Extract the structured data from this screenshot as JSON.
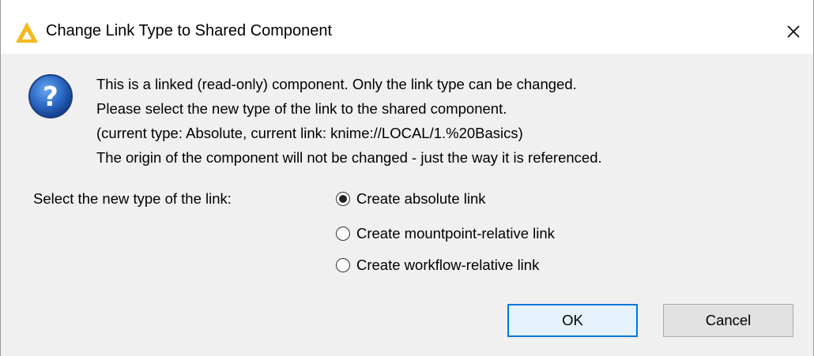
{
  "window": {
    "title": "Change Link Type to Shared Component",
    "close_glyph": "✕",
    "logo_icon": "knime-triangle-logo"
  },
  "message": {
    "icon": "question-icon",
    "lines": [
      "This is a linked (read-only) component. Only the link type can be changed.",
      "Please select the new type of the link to the shared component.",
      "(current type: Absolute, current link: knime://LOCAL/1.%20Basics)",
      "The origin of the component will not be changed - just the way it is referenced."
    ]
  },
  "selection": {
    "label": "Select the new type of the link:",
    "options": [
      {
        "label": "Create absolute link",
        "selected": true
      },
      {
        "label": "Create mountpoint-relative link",
        "selected": false
      },
      {
        "label": "Create workflow-relative link",
        "selected": false
      }
    ]
  },
  "buttons": {
    "ok": "OK",
    "cancel": "Cancel"
  },
  "colors": {
    "accent": "#0078d7",
    "logo_yellow": "#f5b91e",
    "question_blue": "#1f5fb5"
  }
}
